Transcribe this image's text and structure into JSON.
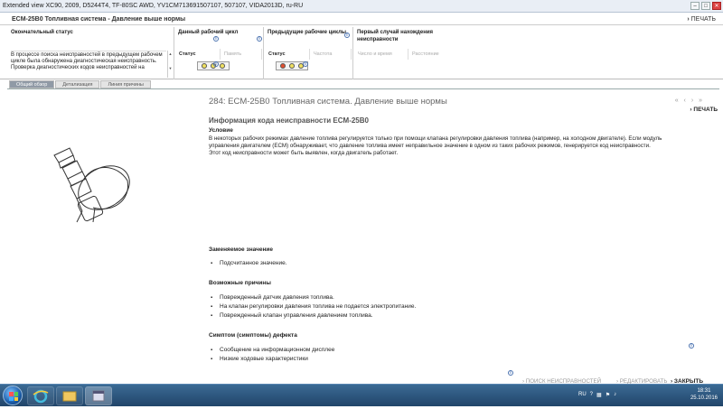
{
  "window": {
    "title": "Extended view   XC90, 2009, D5244T4, TF-80SC AWD, YV1CM71369150710​7, 507107, VIDA2013D, ru-RU",
    "min": "–",
    "max": "□",
    "close": "✕"
  },
  "header": {
    "title": "ECM-25B0 Топливная система - Давление выше нормы",
    "print_label": "ПЕЧАТЬ"
  },
  "status": {
    "final_status_header": "Окончательный статус",
    "final_status_text": "В процессе поиска неисправностей в предыдущем рабочем цикле была обнаружена диагностическая неисправность. Проверка диагностических кодов неисправностей на",
    "current_cycle_header": "Данный рабочий цикл",
    "prev_cycles_header": "Предыдущие рабочие циклы",
    "first_occurrence_header": "Первый случай нахождения неисправности",
    "col_status": "Статус",
    "col_memory": "Память",
    "col_status2": "Статус",
    "col_frequency": "Частота",
    "col_time": "Число и время",
    "col_distance": "Расстояние",
    "current_lights": [
      "#f0e060",
      "#f0e060",
      "#f0e060"
    ],
    "prev_lights": [
      "#e05030",
      "#f0e060",
      "#f0e060"
    ]
  },
  "tabs": [
    {
      "label": "Общий обзор",
      "active": true
    },
    {
      "label": "Детализация",
      "active": false
    },
    {
      "label": "Линия причины",
      "active": false
    }
  ],
  "nav": {
    "arrows": "« ‹ › »",
    "print": "ПЕЧАТЬ"
  },
  "page_title": "284: ECM-25B0 Топливная система. Давление выше нормы",
  "content": {
    "info_heading": "Информация кода неисправности ECM-25B0",
    "condition_heading": "Условие",
    "condition_text": "В некоторых рабочих режимах давление топлива регулируется только при помощи клапана регулировки давления топлива (например, на холодном двигателе). Если модуль управления двигателем (ECM) обнаруживает, что давление топлива имеет неправильное значение в одном из таких рабочих режимов, генерируется код неисправности.",
    "condition_text2": "Этот код неисправности может быть выявлен, когда двигатель работает.",
    "replaced_heading": "Заменяемое значение",
    "replaced_items": [
      "Подсчитанное значение."
    ],
    "causes_heading": "Возможные причины",
    "causes_items": [
      "Поврежденный датчик давления топлива.",
      "На клапан регулировки давления топлива не подается электропитание.",
      "Поврежденный клапан управления давлением топлива."
    ],
    "symptoms_heading": "Симптом (симптомы) дефекта",
    "symptoms_items": [
      "Сообщение на информационном дисплее",
      "Низкие ходовые характеристики"
    ]
  },
  "bottom": {
    "search": "ПОИСК НЕИСПРАВНОСТЕЙ",
    "edit": "РЕДАКТИРОВАТЬ",
    "close": "ЗАКРЫТЬ"
  },
  "taskbar": {
    "lang": "RU",
    "time": "18:31",
    "date": "25.10.2016"
  }
}
